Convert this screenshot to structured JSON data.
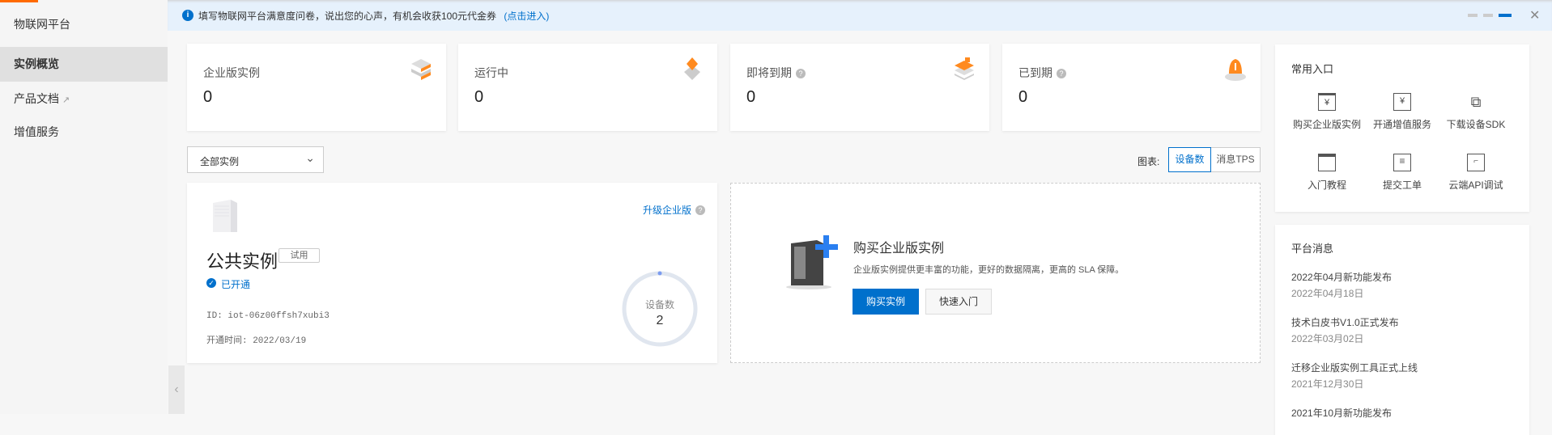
{
  "sidebar": {
    "title": "物联网平台",
    "items": [
      {
        "label": "实例概览",
        "active": true
      },
      {
        "label": "产品文档",
        "external": true
      },
      {
        "label": "增值服务"
      }
    ]
  },
  "banner": {
    "text": "填写物联网平台满意度问卷，说出您的心声，有机会收获100元代金券",
    "link": "(点击进入)",
    "pages": 3,
    "current_page": 3
  },
  "stats": [
    {
      "label": "企业版实例",
      "value": "0",
      "help": false
    },
    {
      "label": "运行中",
      "value": "0",
      "help": false
    },
    {
      "label": "即将到期",
      "value": "0",
      "help": true
    },
    {
      "label": "已到期",
      "value": "0",
      "help": true
    }
  ],
  "filter": {
    "selected": "全部实例"
  },
  "chart_toggle": {
    "label": "图表:",
    "options": [
      "设备数",
      "消息TPS"
    ],
    "active": "设备数"
  },
  "public_instance": {
    "title": "公共实例",
    "tag": "试用",
    "upgrade_link": "升级企业版",
    "status": "已开通",
    "id": "ID: iot-06z00ffsh7xubi3",
    "opened": "开通时间: 2022/03/19",
    "gauge_label": "设备数",
    "gauge_value": "2"
  },
  "buy_card": {
    "title": "购买企业版实例",
    "desc": "企业版实例提供更丰富的功能，更好的数据隔离，更高的 SLA 保障。",
    "primary": "购买实例",
    "secondary": "快速入门"
  },
  "quick_entry": {
    "title": "常用入口",
    "items": [
      "购买企业版实例",
      "开通增值服务",
      "下载设备SDK",
      "入门教程",
      "提交工单",
      "云端API调试"
    ]
  },
  "news": {
    "title": "平台消息",
    "items": [
      {
        "title": "2022年04月新功能发布",
        "date": "2022年04月18日"
      },
      {
        "title": "技术白皮书V1.0正式发布",
        "date": "2022年03月02日"
      },
      {
        "title": "迁移企业版实例工具正式上线",
        "date": "2021年12月30日"
      },
      {
        "title": "2021年10月新功能发布"
      }
    ]
  },
  "colors": {
    "primary": "#0070cc",
    "accent": "#ff6a00"
  }
}
